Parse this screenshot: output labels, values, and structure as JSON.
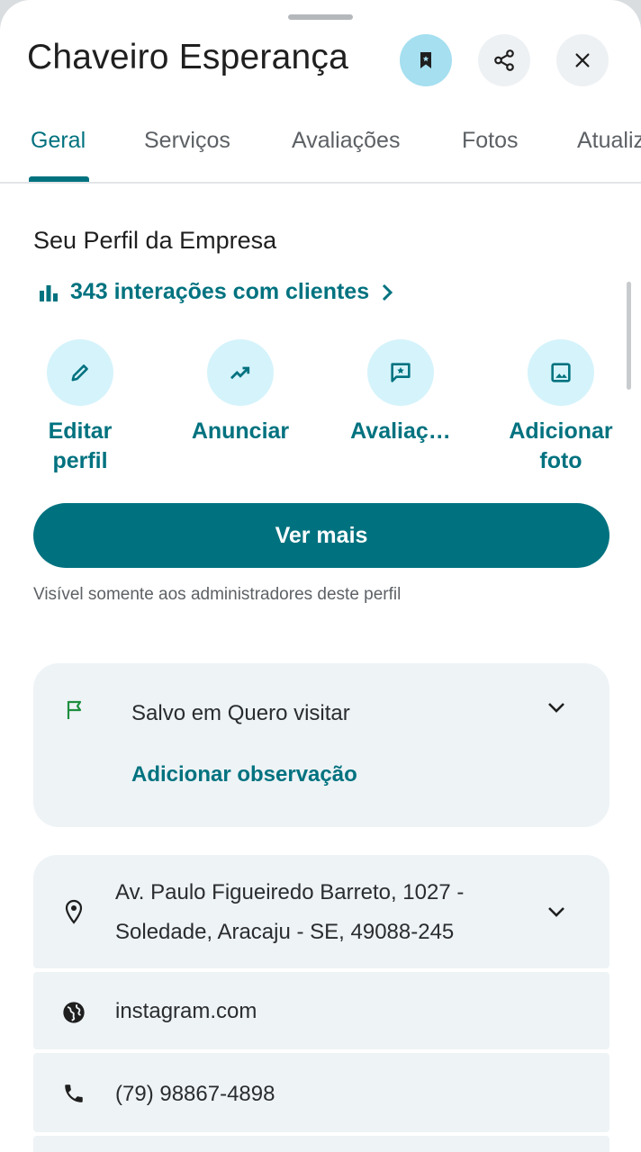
{
  "header": {
    "title": "Chaveiro Esperança"
  },
  "tabs": [
    {
      "label": "Geral",
      "active": true
    },
    {
      "label": "Serviços",
      "active": false
    },
    {
      "label": "Avaliações",
      "active": false
    },
    {
      "label": "Fotos",
      "active": false
    },
    {
      "label": "Atualiz",
      "active": false
    }
  ],
  "profile": {
    "section_title": "Seu Perfil da Empresa",
    "interactions_label": "343 interações com clientes",
    "actions": [
      {
        "label": "Editar perfil",
        "line1": "Editar",
        "line2": "perfil",
        "icon": "pencil-icon"
      },
      {
        "label": "Anunciar",
        "line1": "Anunciar",
        "line2": "",
        "icon": "trending-up-icon"
      },
      {
        "label": "Avaliaç…",
        "line1": "Avaliaç…",
        "line2": "",
        "icon": "review-star-icon"
      },
      {
        "label": "Adicionar foto",
        "line1": "Adicionar",
        "line2": "foto",
        "icon": "image-icon"
      }
    ],
    "cta_label": "Ver mais",
    "visibility_note": "Visível somente aos administradores deste perfil"
  },
  "saved": {
    "status": "Salvo em Quero visitar",
    "add_note": "Adicionar observação"
  },
  "details": {
    "address_line1": "Av. Paulo Figueiredo Barreto, 1027 -",
    "address_line2": "Soledade, Aracaju - SE, 49088-245",
    "website": "instagram.com",
    "phone": "(79) 98867-4898"
  },
  "colors": {
    "accent": "#00727f",
    "icon_circle": "#d5f3fb",
    "card_bg": "#eef3f6",
    "saved_flag": "#1e8e3e"
  }
}
